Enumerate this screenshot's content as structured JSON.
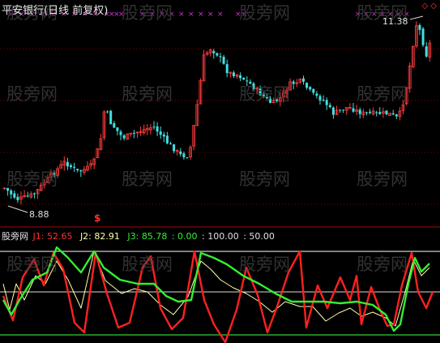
{
  "main_panel": {
    "title": "平安银行(日线 前复权)",
    "high_label": "11.38",
    "low_label": "8.88",
    "diamond_markers": "◇ ◇"
  },
  "indicator_panel": {
    "name": "股旁网",
    "j1_label": "J1: 52.65",
    "j2_label": "J2: 82.91",
    "j3_label": "J3: 85.78",
    "line0_label": ": 0.00",
    "line100_label": ": 100.00",
    "line50_label": ": 50.00",
    "signal_glyph": "$"
  },
  "watermark": "股旁网",
  "colors": {
    "background": "#000000",
    "up_candle": "#ff3c3c",
    "down_candle": "#40e0e0",
    "grid_dotted": "#8a0000",
    "j1_red": "#ff2020",
    "j2_white": "#ffffaa",
    "j3_green": "#33ee33",
    "line100": "#ffffff",
    "line0_green": "#33cc33",
    "purple_marks": "#cc33cc"
  }
}
